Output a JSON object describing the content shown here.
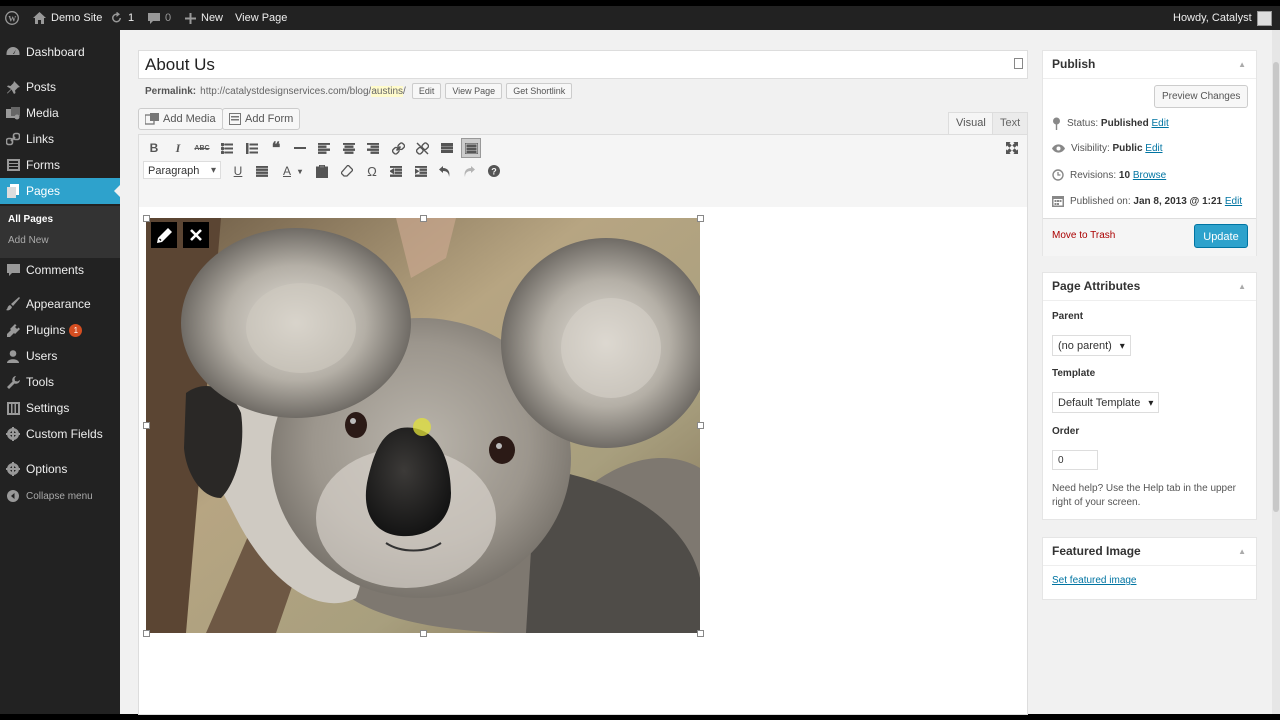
{
  "adminbar": {
    "site_name": "Demo Site",
    "updates_count": "1",
    "comments_count": "0",
    "new_label": "New",
    "view_page_label": "View Page",
    "howdy_label": "Howdy, Catalyst"
  },
  "sidebar": {
    "dashboard": "Dashboard",
    "posts": "Posts",
    "media": "Media",
    "links": "Links",
    "forms": "Forms",
    "pages": "Pages",
    "all_pages": "All Pages",
    "add_new": "Add New",
    "comments": "Comments",
    "appearance": "Appearance",
    "plugins": "Plugins",
    "plugins_badge": "1",
    "users": "Users",
    "tools": "Tools",
    "settings": "Settings",
    "custom_fields": "Custom Fields",
    "options": "Options",
    "collapse": "Collapse menu"
  },
  "editor": {
    "title": "About Us",
    "permalink_label": "Permalink:",
    "permalink_base": "http://catalystdesignservices.com/blog/",
    "permalink_slug": "austins",
    "permalink_tail": "/",
    "edit_btn": "Edit",
    "view_page_btn": "View Page",
    "shortlink_btn": "Get Shortlink",
    "add_media": "Add Media",
    "add_form": "Add Form",
    "tab_visual": "Visual",
    "tab_text": "Text",
    "format_select": "Paragraph",
    "toolbar_bold": "B",
    "toolbar_italic": "I",
    "toolbar_strike": "ABC",
    "toolbar_underline": "U",
    "toolbar_color": "A",
    "toolbar_omega": "Ω"
  },
  "publish": {
    "heading": "Publish",
    "preview_btn": "Preview Changes",
    "status_label": "Status:",
    "status_value": "Published",
    "visibility_label": "Visibility:",
    "visibility_value": "Public",
    "revisions_label": "Revisions:",
    "revisions_value": "10",
    "browse_link": "Browse",
    "published_label": "Published on:",
    "published_value": "Jan 8, 2013 @ 1:21",
    "edit_link": "Edit",
    "trash_link": "Move to Trash",
    "update_btn": "Update"
  },
  "page_attributes": {
    "heading": "Page Attributes",
    "parent_label": "Parent",
    "parent_value": "(no parent)",
    "template_label": "Template",
    "template_value": "Default Template",
    "order_label": "Order",
    "order_value": "0",
    "help_text": "Need help? Use the Help tab in the upper right of your screen."
  },
  "featured_image": {
    "heading": "Featured Image",
    "set_link": "Set featured image"
  },
  "colors": {
    "accent": "#2ea2cc",
    "link": "#0074a2",
    "trash": "#a00",
    "adminbar": "#222222"
  }
}
